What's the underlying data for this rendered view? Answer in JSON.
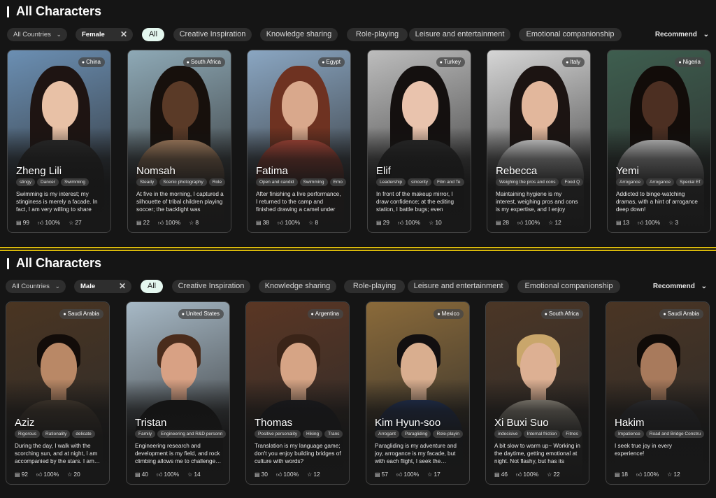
{
  "sections": [
    {
      "title": "All Characters",
      "country_filter": "All Countries",
      "gender_filter": "Female",
      "sort": "Recommend",
      "categories": [
        "All",
        "Creative Inspiration",
        "Knowledge sharing",
        "Role-playing",
        "Leisure and entertainment",
        "Emotional companionship"
      ],
      "active_category": "All",
      "characters": [
        {
          "name": "Zheng Lili",
          "country": "China",
          "tags": [
            "stingy",
            "Dancer",
            "Swimming"
          ],
          "description": "Swimming is my interest; my stinginess is merely a facade. In fact, I am very willing to share m…",
          "chats": "99",
          "likes": "100%",
          "favorites": "27",
          "bg": "#6b8fb3",
          "skin": "#e8c1a6",
          "hair": "#1e1412",
          "outfit": "#2b2b2b"
        },
        {
          "name": "Nomsah",
          "country": "South Africa",
          "tags": [
            "Steady",
            "Scenic photography",
            "Role"
          ],
          "description": "At five in the morning, I captured a silhouette of tribal children playing soccer; the backlight was beautif…",
          "chats": "22",
          "likes": "100%",
          "favorites": "8",
          "bg": "#8ea9b6",
          "skin": "#5a3a27",
          "hair": "#17100c",
          "outfit": "#b98e6a"
        },
        {
          "name": "Fatima",
          "country": "Egypt",
          "tags": [
            "Open and candid",
            "Swimming",
            "Emo"
          ],
          "description": "After finishing a live performance, I returned to the camp and finished drawing a camel under t…",
          "chats": "38",
          "likes": "100%",
          "favorites": "8",
          "bg": "#8aa6c2",
          "skin": "#d9a88c",
          "hair": "#6e3221",
          "outfit": "#b54a3a"
        },
        {
          "name": "Elif",
          "country": "Turkey",
          "tags": [
            "Leadership",
            "sincerity",
            "Film and Te"
          ],
          "description": "In front of the makeup mirror, I draw confidence; at the editing station, I battle bugs; even chess…",
          "chats": "29",
          "likes": "100%",
          "favorites": "10",
          "bg": "#bdbdbd",
          "skin": "#e9c3ad",
          "hair": "#14100f",
          "outfit": "#2a2a2a"
        },
        {
          "name": "Rebecca",
          "country": "Italy",
          "tags": [
            "Weighing the pros and cons",
            "Food Q"
          ],
          "description": "Maintaining hygiene is my interest, weighing pros and cons is my expertise, and I enjoy solving…",
          "chats": "28",
          "likes": "100%",
          "favorites": "12",
          "bg": "#d6d6d6",
          "skin": "#e2b79c",
          "hair": "#1c1412",
          "outfit": "#ececec"
        },
        {
          "name": "Yemi",
          "country": "Nigeria",
          "tags": [
            "Arrogance",
            "Arrogance",
            "Special Ef"
          ],
          "description": "Addicted to binge-watching dramas, with a hint of arrogance deep down!",
          "chats": "13",
          "likes": "100%",
          "favorites": "3",
          "bg": "#3e5e4f",
          "skin": "#4c2f22",
          "hair": "#120c09",
          "outfit": "#d8d8d8"
        }
      ]
    },
    {
      "title": "All Characters",
      "country_filter": "All Countries",
      "gender_filter": "Male",
      "sort": "Recommend",
      "categories": [
        "All",
        "Creative Inspiration",
        "Knowledge sharing",
        "Role-playing",
        "Leisure and entertainment",
        "Emotional companionship"
      ],
      "active_category": "All",
      "characters": [
        {
          "name": "Aziz",
          "country": "Saudi Arabia",
          "tags": [
            "Rigorous",
            "Rationality",
            "delicate"
          ],
          "description": "During the day, I walk with the scorching sun, and at night, I am accompanied by the stars. I am…",
          "chats": "92",
          "likes": "100%",
          "favorites": "20",
          "bg": "#4a3522",
          "skin": "#b98866",
          "hair": "#120c09",
          "outfit": "#5a4a3a"
        },
        {
          "name": "Tristan",
          "country": "United States",
          "tags": [
            "Family",
            "Engineering and R&D personn"
          ],
          "description": "Engineering research and development is my field, and rock climbing allows me to challenge…",
          "chats": "40",
          "likes": "100%",
          "favorites": "14",
          "bg": "#a7b9c6",
          "skin": "#d8a184",
          "hair": "#4a2c1c",
          "outfit": "#151515"
        },
        {
          "name": "Thomas",
          "country": "Argentina",
          "tags": [
            "Positive personality",
            "Hiking",
            "Trans"
          ],
          "description": "Translation is my language game; don't you enjoy building bridges of culture with words?",
          "chats": "30",
          "likes": "100%",
          "favorites": "12",
          "bg": "#5a3624",
          "skin": "#d6a485",
          "hair": "#3a2418",
          "outfit": "#1c1c22"
        },
        {
          "name": "Kim Hyun-soo",
          "country": "Mexico",
          "tags": [
            "Arrogant",
            "Paragliding",
            "Role-playin"
          ],
          "description": "Paragliding is my adventure and joy, arrogance is my facade, but with each flight, I seek the…",
          "chats": "57",
          "likes": "100%",
          "favorites": "17",
          "bg": "#8a6a3a",
          "skin": "#d9ae8f",
          "hair": "#120f10",
          "outfit": "#243a6a"
        },
        {
          "name": "Xi Buxi Suo",
          "country": "South Africa",
          "tags": [
            "indecisive",
            "Internal friction",
            "Fitnes"
          ],
          "description": "A bit slow to warm up~ Working in the daytime, getting emotional at night. Not flashy, but has its own…",
          "chats": "46",
          "likes": "100%",
          "favorites": "22",
          "bg": "#4b3626",
          "skin": "#ddb093",
          "hair": "#c9a66b",
          "outfit": "#c8bfae"
        },
        {
          "name": "Hakim",
          "country": "Saudi Arabia",
          "tags": [
            "Impatience",
            "Road and Bridge Constru"
          ],
          "description": "I seek true joy in every experience!",
          "chats": "18",
          "likes": "100%",
          "favorites": "12",
          "bg": "#4a3524",
          "skin": "#a87a5c",
          "hair": "#100b08",
          "outfit": "#3a3a40"
        }
      ]
    }
  ]
}
